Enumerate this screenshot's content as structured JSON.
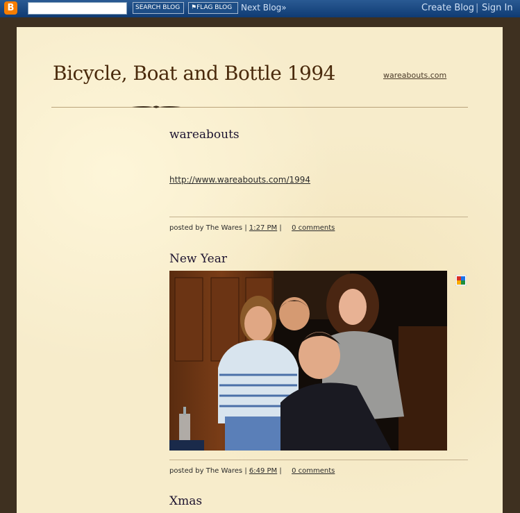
{
  "navbar": {
    "logo_letter": "B",
    "search_placeholder": "",
    "search_button": "SEARCH BLOG",
    "flag_button": "⚑FLAG BLOG",
    "next_blog": "Next Blog»",
    "create_blog": "Create Blog",
    "separator": "|",
    "sign_in": "Sign In"
  },
  "blog": {
    "title": "Bicycle, Boat and Bottle 1994",
    "header_link": "wareabouts.com"
  },
  "posts": [
    {
      "title": "wareabouts",
      "link": "http://www.wareabouts.com/1994",
      "posted_by_prefix": "posted by The Wares",
      "time": "1:27 PM",
      "comments": "0 comments"
    },
    {
      "title": "New Year",
      "posted_by_prefix": "posted by The Wares",
      "time": "6:49 PM",
      "comments": "0 comments"
    },
    {
      "title": "Xmas"
    }
  ],
  "colors": {
    "navbar": "#0f3b73",
    "page_background": "#f7eccb",
    "outer_background": "#3e3020",
    "title": "#4a2a0c",
    "logo": "#f57d00"
  },
  "icons": {
    "blogger_logo": "blogger-logo-icon",
    "flag": "flag-icon",
    "picasa": "picasa-icon"
  }
}
